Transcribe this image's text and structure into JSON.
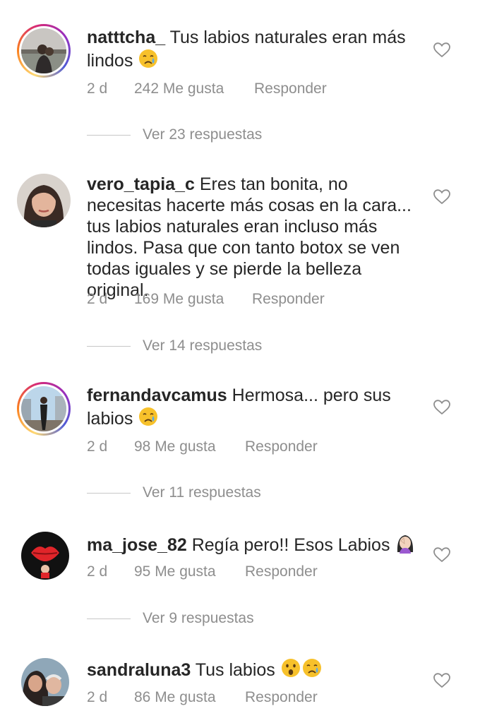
{
  "comments": [
    {
      "username": "natttcha_",
      "text": " Tus labios naturales eran más lindos",
      "emojis": [
        "crying-face"
      ],
      "time": "2 d",
      "likes": "242 Me gusta",
      "reply": "Responder",
      "view_replies": "Ver 23 respuestas",
      "story_ring": true
    },
    {
      "username": "vero_tapia_c",
      "text": " Eres tan bonita, no necesitas hacerte más cosas en la cara... tus labios naturales eran incluso más lindos. Pasa que con tanto botox se ven todas iguales y se pierde la belleza original.",
      "emojis": [],
      "time": "2 d",
      "likes": "169 Me gusta",
      "reply": "Responder",
      "view_replies": "Ver 14 respuestas",
      "story_ring": false
    },
    {
      "username": "fernandavcamus",
      "text": " Hermosa... pero sus labios",
      "emojis": [
        "crying-face"
      ],
      "time": "2 d",
      "likes": "98 Me gusta",
      "reply": "Responder",
      "view_replies": "Ver 11 respuestas",
      "story_ring": true
    },
    {
      "username": "ma_jose_82",
      "text": " Regía pero!! Esos Labios",
      "emojis": [
        "facepalm-woman"
      ],
      "time": "2 d",
      "likes": "95 Me gusta",
      "reply": "Responder",
      "view_replies": "Ver 9 respuestas",
      "story_ring": false
    },
    {
      "username": "sandraluna3",
      "text": " Tus labios",
      "emojis": [
        "astonished-face",
        "crying-face"
      ],
      "time": "2 d",
      "likes": "86 Me gusta",
      "reply": "Responder",
      "story_ring": false
    }
  ],
  "colors": {
    "text": "#262626",
    "secondary": "#8e8e8e",
    "divider": "#c7c7c7",
    "emoji_yellow": "#f7c12b",
    "tear_blue": "#5aa9e6"
  }
}
